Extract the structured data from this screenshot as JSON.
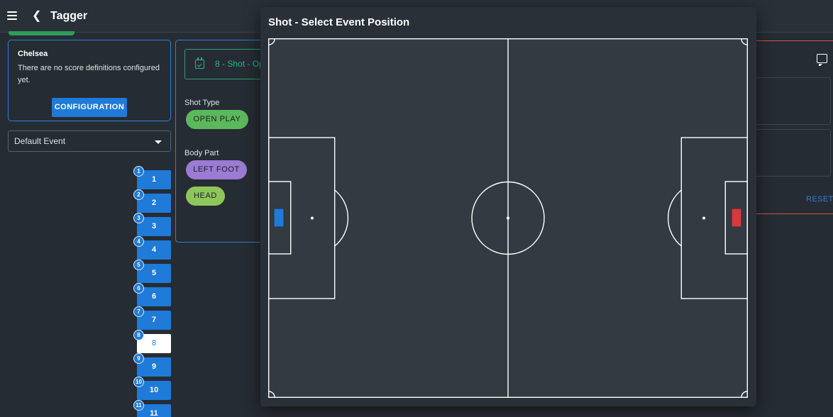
{
  "header": {
    "title": "Tagger"
  },
  "team_card": {
    "team_name": "Chelsea",
    "message": "There are no score definitions configured yet.",
    "config_button": "CONFIGURATION"
  },
  "event_select": {
    "value": "Default Event"
  },
  "players": [
    {
      "badge": "1",
      "label": "1"
    },
    {
      "badge": "2",
      "label": "2"
    },
    {
      "badge": "3",
      "label": "3"
    },
    {
      "badge": "4",
      "label": "4"
    },
    {
      "badge": "5",
      "label": "5"
    },
    {
      "badge": "6",
      "label": "6"
    },
    {
      "badge": "7",
      "label": "7"
    },
    {
      "badge": "8",
      "label": "8"
    },
    {
      "badge": "9",
      "label": "9"
    },
    {
      "badge": "10",
      "label": "10"
    },
    {
      "badge": "11",
      "label": "11"
    }
  ],
  "selected_player": "8",
  "event_panel": {
    "event_value": "8 - Shot - Op",
    "shot_type_label": "Shot Type",
    "shot_type_chip": "OPEN PLAY",
    "body_part_label": "Body Part",
    "body_part_chips": [
      "LEFT FOOT",
      "HEAD"
    ]
  },
  "right_panel": {
    "reset_label": "RESET"
  },
  "dialog": {
    "title": "Shot - Select Event Position"
  },
  "colors": {
    "primary_blue": "#1f7ad8",
    "accent_green": "#2fb388",
    "chip_green": "#5cb85c",
    "chip_purple": "#9b7bd4",
    "chip_lime": "#8fc65c",
    "goal_left": "#1f7ad8",
    "goal_right": "#d63a3a",
    "pitch_bg": "#343a42",
    "pitch_line": "#ffffff"
  }
}
